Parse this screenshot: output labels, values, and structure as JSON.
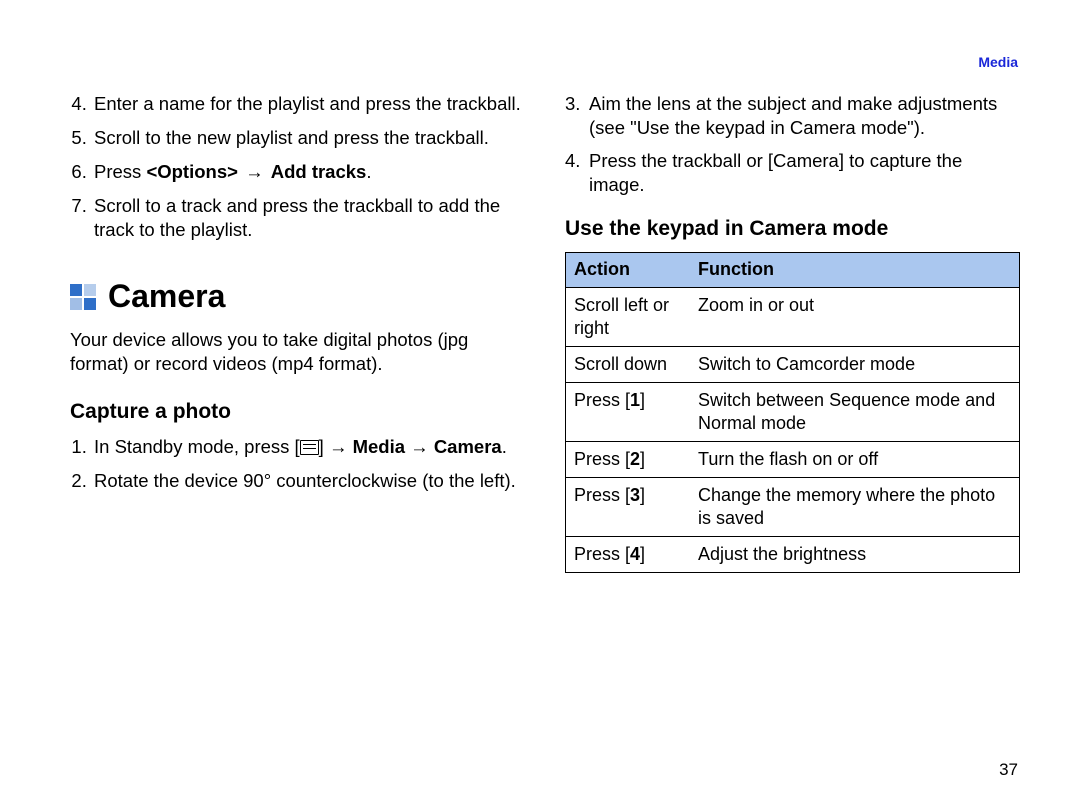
{
  "header": {
    "section": "Media"
  },
  "left": {
    "steps_start_4": [
      {
        "text": "Enter a name for the playlist and press the trackball."
      },
      {
        "text": "Scroll to the new playlist and press the trackball."
      },
      {
        "prefix": "Press ",
        "bold1": "<Options>",
        "arrow": " → ",
        "bold2": "Add tracks",
        "suffix": "."
      },
      {
        "text": "Scroll to a track and press the trackball to add the track to the playlist."
      }
    ],
    "camera_heading": "Camera",
    "camera_intro": "Your device allows you to take digital photos (jpg format) or record videos (mp4 format).",
    "capture_heading": "Capture a photo",
    "capture_steps": [
      {
        "prefix": "In Standby mode, press [",
        "icon": true,
        "mid": "] ",
        "arrow1": "→ ",
        "bold1": "Media",
        "arrow2": " → ",
        "bold2": "Camera",
        "suffix": "."
      },
      {
        "text": "Rotate the device 90° counterclockwise (to the left)."
      }
    ]
  },
  "right": {
    "cont_steps": [
      {
        "text": "Aim the lens at the subject and make adjustments (see \"Use the keypad in Camera mode\")."
      },
      {
        "text": "Press the trackball or [Camera] to capture the image."
      }
    ],
    "keypad_heading": "Use the keypad in Camera mode",
    "table_headers": {
      "col1": "Action",
      "col2": "Function"
    },
    "table_rows": [
      {
        "action": "Scroll left or right",
        "function": "Zoom in or out"
      },
      {
        "action": "Scroll down",
        "function": "Switch to Camcorder mode"
      },
      {
        "action_pre": "Press [",
        "action_bold": "1",
        "action_post": "]",
        "function": "Switch between Sequence mode and Normal mode"
      },
      {
        "action_pre": "Press [",
        "action_bold": "2",
        "action_post": "]",
        "function": "Turn the flash on or off"
      },
      {
        "action_pre": "Press [",
        "action_bold": "3",
        "action_post": "]",
        "function": "Change the memory where the photo is saved"
      },
      {
        "action_pre": "Press [",
        "action_bold": "4",
        "action_post": "]",
        "function": "Adjust the brightness"
      }
    ]
  },
  "page_number": "37"
}
